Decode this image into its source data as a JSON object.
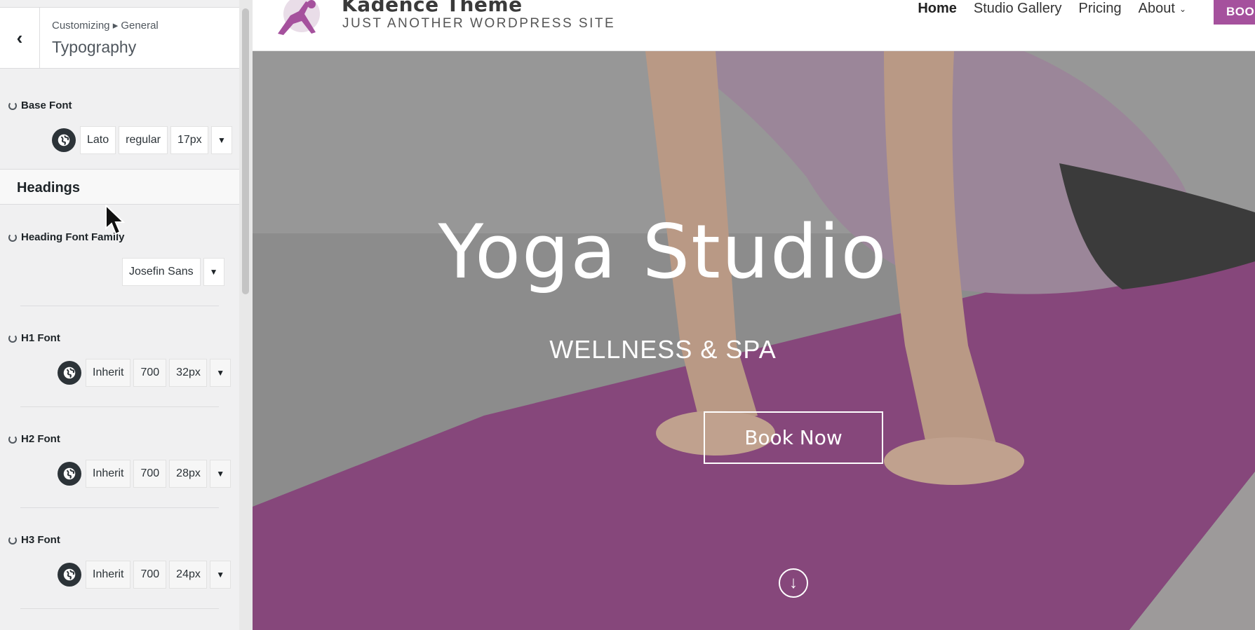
{
  "customizer": {
    "breadcrumb": "Customizing ▸ General",
    "section_title": "Typography",
    "base_font": {
      "label": "Base Font",
      "family": "Lato",
      "weight": "regular",
      "size": "17px"
    },
    "headings_title": "Headings",
    "heading_family": {
      "label": "Heading Font Family",
      "family": "Josefin Sans"
    },
    "h1": {
      "label": "H1 Font",
      "family": "Inherit",
      "weight": "700",
      "size": "32px"
    },
    "h2": {
      "label": "H2 Font",
      "family": "Inherit",
      "weight": "700",
      "size": "28px"
    },
    "h3": {
      "label": "H3 Font",
      "family": "Inherit",
      "weight": "700",
      "size": "24px"
    }
  },
  "site": {
    "title": "Kadence Theme",
    "tagline": "JUST ANOTHER WORDPRESS SITE",
    "nav": [
      "Home",
      "Studio Gallery",
      "Pricing",
      "About"
    ],
    "header_button": "BOO",
    "hero_title": "Yoga Studio",
    "hero_subtitle": "WELLNESS & SPA",
    "hero_button": "Book Now"
  },
  "colors": {
    "accent": "#a5519d",
    "mat": "#9b4f8e"
  },
  "icons": {
    "back": "chevron-left-icon",
    "reset": "reset-icon",
    "globe": "globe-icon",
    "dropdown": "triangle-down-icon",
    "scroll": "arrow-down-circle-icon"
  }
}
